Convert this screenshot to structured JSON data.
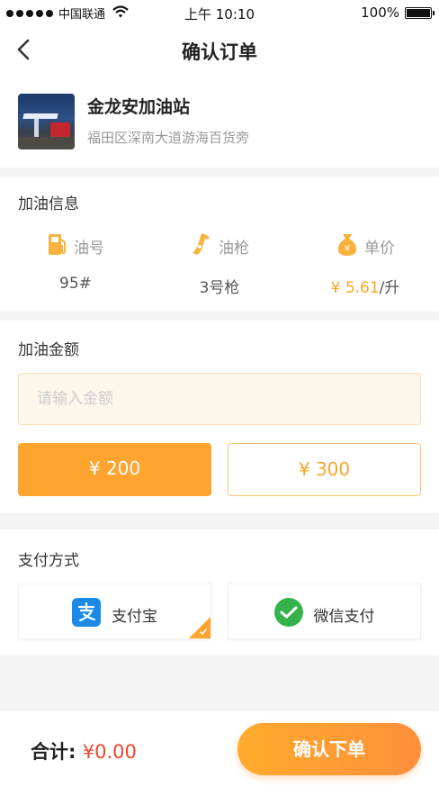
{
  "status_bar": {
    "carrier": "中国联通",
    "time": "上午 10:10",
    "battery": "100%"
  },
  "nav": {
    "title": "确认订单",
    "back_icon": "back-arrow-icon"
  },
  "station": {
    "name": "金龙安加油站",
    "address": "福田区深南大道游海百货旁"
  },
  "fuel_info": {
    "title": "加油信息",
    "items": [
      {
        "label": "油号",
        "value": "95#",
        "icon": "fuel-pump-icon"
      },
      {
        "label": "油枪",
        "value": "3号枪",
        "icon": "fuel-nozzle-icon"
      },
      {
        "label": "单价",
        "price": "¥ 5.61",
        "unit": "/升",
        "icon": "money-bag-icon"
      }
    ]
  },
  "amount": {
    "title": "加油金额",
    "placeholder": "请输入金额",
    "options": [
      {
        "label": "¥ 200",
        "selected": true
      },
      {
        "label": "¥ 300",
        "selected": false
      }
    ]
  },
  "payment": {
    "title": "支付方式",
    "options": [
      {
        "label": "支付宝",
        "selected": true,
        "icon": "alipay-icon"
      },
      {
        "label": "微信支付",
        "selected": false,
        "icon": "wechat-pay-icon"
      }
    ]
  },
  "footer": {
    "total_label": "合计: ",
    "total_value": "¥0.00",
    "submit_label": "确认下单"
  },
  "colors": {
    "accent": "#ffa42f",
    "price": "#f5a623",
    "total": "#f2432b",
    "alipay": "#1a8ae6",
    "wechat": "#33b34a"
  }
}
